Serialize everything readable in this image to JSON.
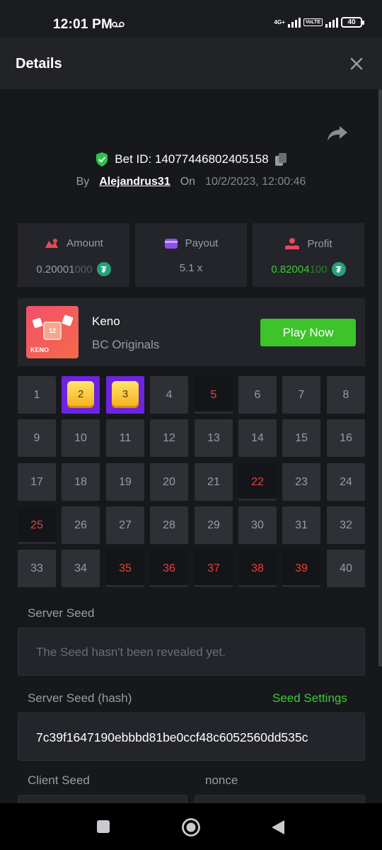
{
  "status_bar": {
    "time": "12:01 PM",
    "network": "4G+",
    "volte": "VoLTE",
    "battery": "40"
  },
  "header": {
    "title": "Details"
  },
  "bet": {
    "id_text": "Bet ID: 14077446802405158",
    "by_label": "By",
    "user": "Alejandrus31",
    "on_label": "On",
    "date": "10/2/2023, 12:00:46"
  },
  "stats": {
    "amount": {
      "label": "Amount",
      "value_main": "0.20001",
      "value_dim": "000",
      "currency": "tether-icon"
    },
    "payout": {
      "label": "Payout",
      "value": "5.1 x"
    },
    "profit": {
      "label": "Profit",
      "value_main": "0.82004",
      "value_dim": "100",
      "currency": "tether-icon"
    }
  },
  "game": {
    "thumb_number": "12",
    "thumb_label": "KENO",
    "name": "Keno",
    "provider": "BC Originals",
    "play_label": "Play Now"
  },
  "keno_grid": {
    "numbers": [
      "1",
      "2",
      "3",
      "4",
      "5",
      "6",
      "7",
      "8",
      "9",
      "10",
      "11",
      "12",
      "13",
      "14",
      "15",
      "16",
      "17",
      "18",
      "19",
      "20",
      "21",
      "22",
      "23",
      "24",
      "25",
      "26",
      "27",
      "28",
      "29",
      "30",
      "31",
      "32",
      "33",
      "34",
      "35",
      "36",
      "37",
      "38",
      "39",
      "40"
    ],
    "selected": [
      2,
      3
    ],
    "drawn": [
      5,
      22,
      25,
      35,
      36,
      37,
      38,
      39
    ]
  },
  "seeds": {
    "server_seed_label": "Server Seed",
    "server_seed_value": "The Seed hasn't been revealed yet.",
    "server_seed_hash_label": "Server Seed (hash)",
    "seed_settings_label": "Seed Settings",
    "server_seed_hash_value": "7c39f1647190ebbbd81be0ccf48c6052560dd535c",
    "client_seed_label": "Client Seed",
    "nonce_label": "nonce"
  },
  "colors": {
    "accent_green": "#3cc42a",
    "selected_purple": "#6c24df",
    "drawn_red": "#e5423e"
  }
}
